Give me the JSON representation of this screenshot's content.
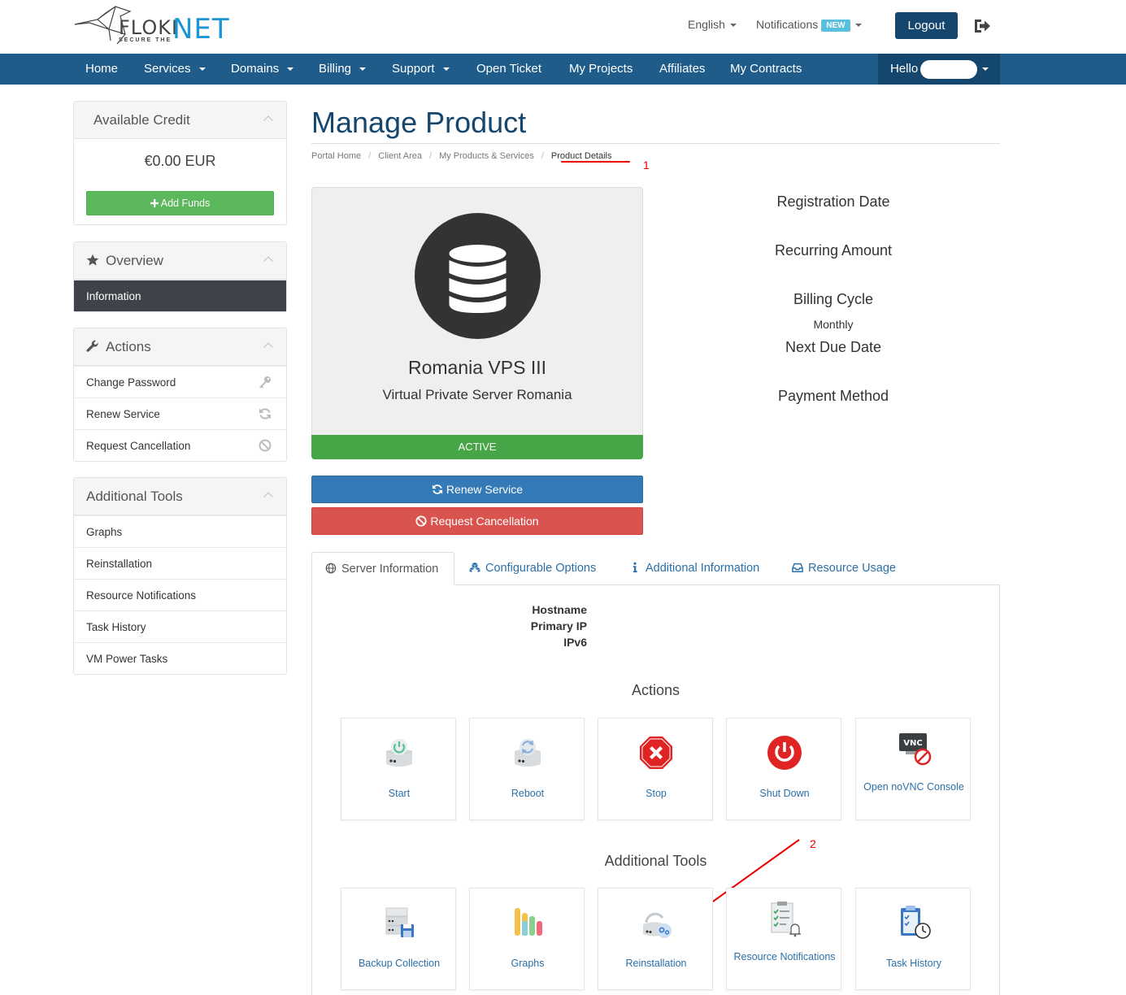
{
  "header": {
    "logo_main": "FLOKI",
    "logo_accent": "NET",
    "logo_tagline": "SECURE THE",
    "language": "English",
    "notifications": "Notifications",
    "notifications_badge": "NEW",
    "logout": "Logout"
  },
  "nav": {
    "items": [
      "Home",
      "Services",
      "Domains",
      "Billing",
      "Support",
      "Open Ticket",
      "My Projects",
      "Affiliates",
      "My Contracts"
    ],
    "hello": "Hello"
  },
  "sidebar": {
    "credit": {
      "title": "Available Credit",
      "amount": "€0.00 EUR",
      "add_funds": "Add Funds"
    },
    "overview": {
      "title": "Overview",
      "items": [
        "Information"
      ]
    },
    "actions": {
      "title": "Actions",
      "items": [
        "Change Password",
        "Renew Service",
        "Request Cancellation"
      ]
    },
    "tools": {
      "title": "Additional Tools",
      "items": [
        "Graphs",
        "Reinstallation",
        "Resource Notifications",
        "Task History",
        "VM Power Tasks"
      ]
    }
  },
  "main": {
    "title": "Manage Product",
    "breadcrumb": [
      "Portal Home",
      "Client Area",
      "My Products & Services",
      "Product Details"
    ],
    "annotation_1": "1",
    "annotation_2": "2",
    "product": {
      "name": "Romania VPS III",
      "group": "Virtual Private Server Romania",
      "status": "ACTIVE"
    },
    "renew_button": "Renew Service",
    "cancel_button": "Request Cancellation",
    "details": {
      "registration_date": "Registration Date",
      "recurring_amount": "Recurring Amount",
      "billing_cycle": "Billing Cycle",
      "billing_cycle_value": "Monthly",
      "next_due_date": "Next Due Date",
      "payment_method": "Payment Method"
    },
    "tabs": [
      "Server Information",
      "Configurable Options",
      "Additional Information",
      "Resource Usage"
    ],
    "server_info": {
      "hostname": "Hostname",
      "primary_ip": "Primary IP",
      "ipv6": "IPv6"
    },
    "actions_title": "Actions",
    "action_tiles": [
      "Start",
      "Reboot",
      "Stop",
      "Shut Down",
      "Open noVNC Console"
    ],
    "vnc_icon_text": "VNC",
    "tools_title": "Additional Tools",
    "tool_tiles": [
      "Backup Collection",
      "Graphs",
      "Reinstallation",
      "Resource Notifications",
      "Task History"
    ]
  },
  "colors": {
    "brand_blue": "#1f5c8a",
    "dark_blue": "#15466e",
    "success": "#46a546",
    "danger": "#d9534f",
    "primary": "#337ab7",
    "annotation": "#e00000"
  }
}
